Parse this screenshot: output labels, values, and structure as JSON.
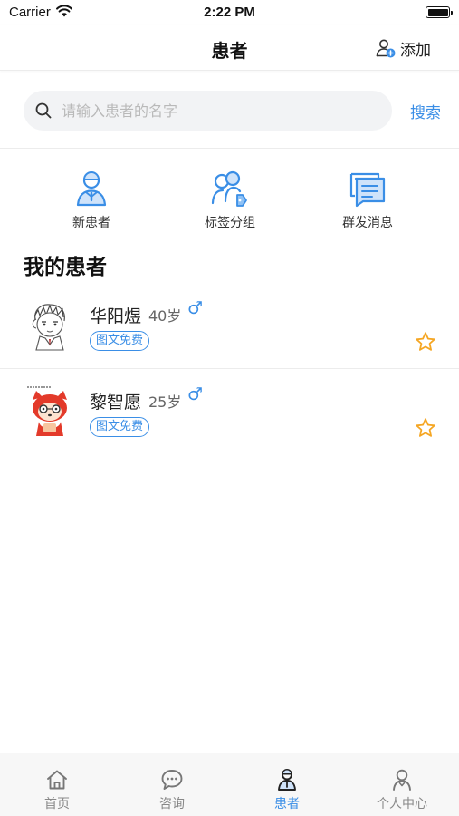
{
  "status_bar": {
    "carrier": "Carrier",
    "time": "2:22 PM"
  },
  "nav": {
    "title": "患者",
    "add_label": "添加"
  },
  "search": {
    "placeholder": "请输入患者的名字",
    "value": "",
    "button_label": "搜索"
  },
  "quick_actions": [
    {
      "label": "新患者",
      "icon": "new-patient-icon"
    },
    {
      "label": "标签分组",
      "icon": "tag-group-icon"
    },
    {
      "label": "群发消息",
      "icon": "broadcast-message-icon"
    }
  ],
  "section": {
    "title": "我的患者"
  },
  "patients": [
    {
      "name": "华阳煜",
      "age": "40岁",
      "gender": "♂",
      "badge": "图文免费",
      "avatar": "sketch-boy-avatar",
      "starred": false
    },
    {
      "name": "黎智愿",
      "age": "25岁",
      "gender": "♂",
      "badge": "图文免费",
      "avatar": "red-fox-avatar",
      "starred": false
    }
  ],
  "tab_bar": {
    "tabs": [
      {
        "label": "首页",
        "icon": "home-icon",
        "active": false
      },
      {
        "label": "咨询",
        "icon": "chat-icon",
        "active": false
      },
      {
        "label": "患者",
        "icon": "patient-icon",
        "active": true
      },
      {
        "label": "个人中心",
        "icon": "profile-icon",
        "active": false
      }
    ]
  },
  "colors": {
    "accent": "#3a8ee6",
    "star": "#f5a623",
    "text": "#222222",
    "muted": "#888888"
  }
}
